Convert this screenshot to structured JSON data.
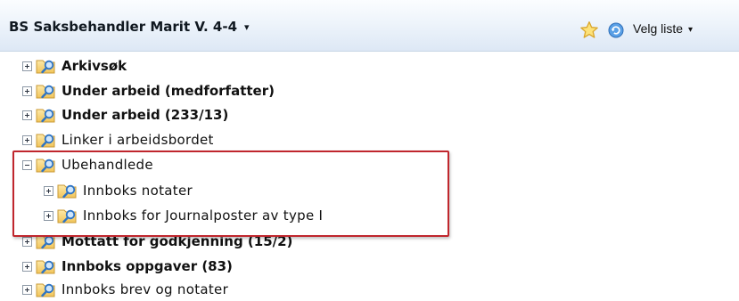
{
  "header": {
    "title": "BS Saksbehandler Marit V.  4-4",
    "caret": "▾",
    "star_icon": "star-icon",
    "refresh_icon": "refresh-icon",
    "pick_list_label": "Velg liste",
    "pick_list_caret": "▾"
  },
  "tree": {
    "folder_icon": "folder-search-icon",
    "items": [
      {
        "label": "Arkivsøk",
        "expanded": false,
        "bold": true,
        "level": 0
      },
      {
        "label": "Under arbeid (medforfatter)",
        "expanded": false,
        "bold": true,
        "level": 0
      },
      {
        "label": "Under arbeid (233/13)",
        "expanded": false,
        "bold": true,
        "level": 0
      },
      {
        "label": "Linker i arbeidsbordet",
        "expanded": false,
        "bold": false,
        "level": 0
      },
      {
        "label": "Ubehandlede",
        "expanded": true,
        "bold": false,
        "level": 0
      },
      {
        "label": "Innboks notater",
        "expanded": false,
        "bold": false,
        "level": 1
      },
      {
        "label": "Innboks for Journalposter av type I",
        "expanded": false,
        "bold": false,
        "level": 1
      },
      {
        "label": "Mottatt for godkjenning (15/2)",
        "expanded": false,
        "bold": true,
        "level": 0
      },
      {
        "label": "Innboks oppgaver (83)",
        "expanded": false,
        "bold": true,
        "level": 0
      },
      {
        "label": "Innboks brev og notater",
        "expanded": false,
        "bold": false,
        "level": 0
      }
    ]
  },
  "colors": {
    "highlight_border": "#c0262d",
    "header_gradient_top": "#fbfdff",
    "header_gradient_bottom": "#dde8f5"
  }
}
